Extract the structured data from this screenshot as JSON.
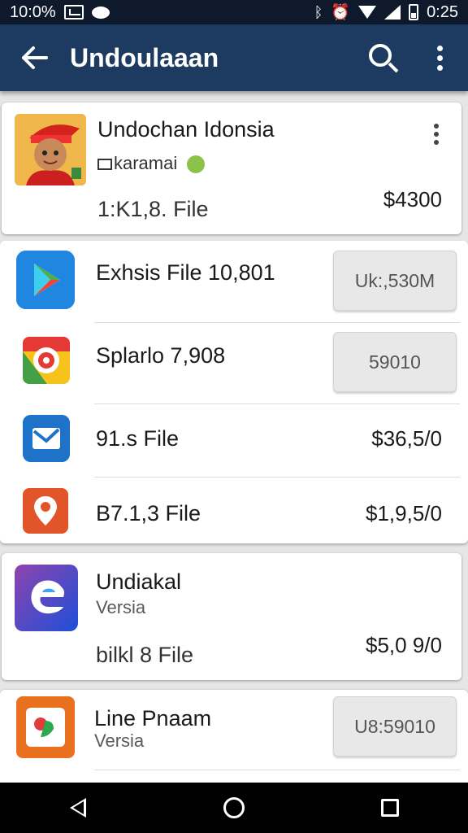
{
  "status_bar": {
    "left_text": "10:0%",
    "time": "0:25",
    "icons": [
      "screenshot-icon",
      "chat-bubble-icon",
      "bluetooth-icon",
      "alarm-icon",
      "wifi-icon",
      "signal-icon",
      "battery-icon"
    ]
  },
  "app_bar": {
    "title": "Undoulaaan",
    "back_icon": "arrow-left-icon",
    "search_icon": "search-icon",
    "menu_icon": "more-vert-icon",
    "color": "#1d3a60"
  },
  "featured": {
    "name": "Undochan Idonsia",
    "sub": "karamai",
    "sub_icon": "card-icon",
    "emoji_icon": "smiley-icon",
    "file": "1:K1,8. File",
    "price": "$4300"
  },
  "items": [
    {
      "name": "Exhsis File 10,801",
      "button": "Uk:,530M",
      "icon": "play-store-icon"
    },
    {
      "name": "Splarlo 7,908",
      "button": "59010",
      "icon": "chrome-icon"
    },
    {
      "name": "91.s File",
      "price": "$36,5/0",
      "icon": "mail-icon"
    },
    {
      "name": "B7.1,3 File",
      "price": "$1,9,5/0",
      "icon": "maps-pin-icon"
    }
  ],
  "card2": {
    "name": "Undiakal",
    "sub": "Versia",
    "file": "bilkl 8 File",
    "price": "$5,0 9/0",
    "icon": "edge-icon"
  },
  "last": {
    "name": "Line Pnaam",
    "sub": "Versia",
    "button": "U8:59010",
    "icon": "photos-icon"
  },
  "nav": {
    "back": "nav-back-icon",
    "home": "nav-home-icon",
    "recents": "nav-recents-icon"
  }
}
